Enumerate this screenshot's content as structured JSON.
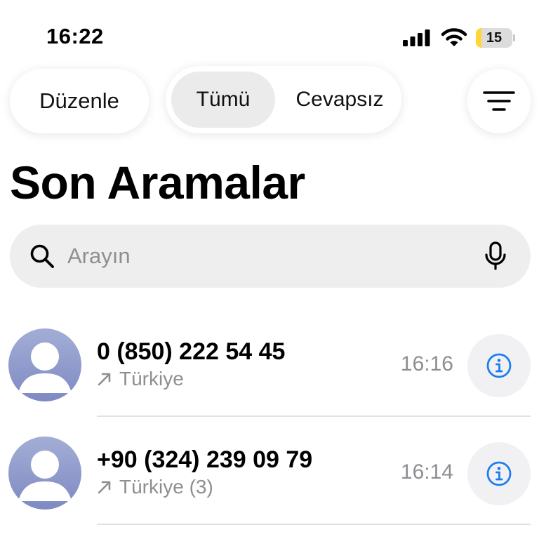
{
  "status_bar": {
    "time": "16:22",
    "battery_level": "15",
    "battery_fraction": 0.15,
    "icons": [
      "signal-icon",
      "wifi-icon",
      "battery-icon"
    ]
  },
  "toolbar": {
    "edit_label": "Düzenle",
    "segments": [
      {
        "label": "Tümü",
        "selected": true
      },
      {
        "label": "Cevapsız",
        "selected": false
      }
    ],
    "filter_icon": "filter-lines-icon"
  },
  "page_title": "Son Aramalar",
  "search": {
    "placeholder": "Arayın",
    "value": "",
    "icons": [
      "search-icon",
      "mic-icon"
    ]
  },
  "calls": [
    {
      "number": "0 (850) 222 54 45",
      "location": "Türkiye",
      "time": "16:16",
      "direction": "outgoing"
    },
    {
      "number": "+90 (324) 239 09 79",
      "location": "Türkiye (3)",
      "time": "16:14",
      "direction": "outgoing"
    }
  ],
  "colors": {
    "accent": "#1a7cf0",
    "secondary_text": "#8e8e93",
    "battery_fill": "#ffd633",
    "avatar_top": "#a3aed6",
    "avatar_bottom": "#7e8ac2",
    "search_background": "#eeeeef"
  }
}
